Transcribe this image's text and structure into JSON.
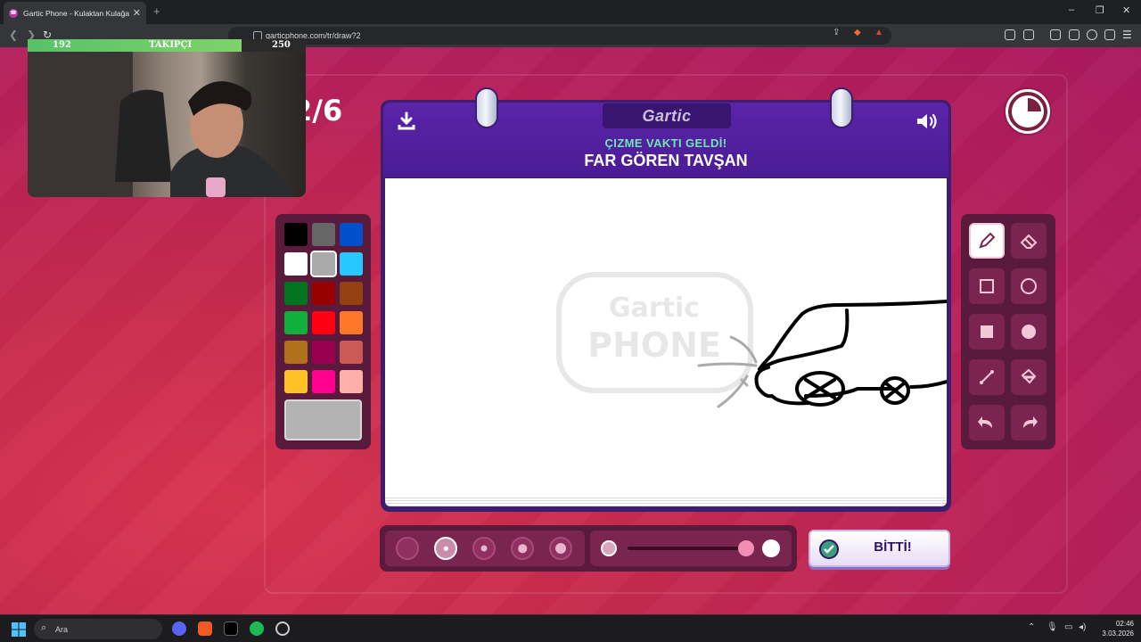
{
  "browser": {
    "tab_title": "Gartic Phone - Kulaktan Kulağa",
    "tab_close": "✕",
    "new_tab": "+",
    "url": "garticphone.com/tr/draw?2",
    "window_controls": [
      "–",
      "❐",
      "✕"
    ]
  },
  "stream": {
    "follow_current": "192",
    "follow_label": "TAKIPÇI",
    "follow_goal": "250",
    "follow_progress": 0.77
  },
  "game": {
    "round_text": "2/6",
    "logo_text": "Gartic",
    "subtitle": "ÇIZME VAKTI GELDİ!",
    "prompt": "FAR GÖREN TAVŞAN",
    "watermark_top": "Gartic",
    "watermark_bottom": "PHONE",
    "done_label": "BİTTİ!",
    "timer_remaining": 0.75,
    "palette": [
      "#000000",
      "#666666",
      "#0050cd",
      "#ffffff",
      "#aaaaaa",
      "#26c9ff",
      "#017420",
      "#990000",
      "#964112",
      "#11b03c",
      "#ff0013",
      "#ff7829",
      "#b0701c",
      "#99004e",
      "#cb5a57",
      "#ffc126",
      "#ff008f",
      "#feafa8"
    ],
    "selected_color": "#aaaaaa",
    "big_swatch_color": "#b3b3b3",
    "tools": [
      "pencil-icon",
      "eraser-icon",
      "rectangle-outline-icon",
      "circle-outline-icon",
      "rectangle-fill-icon",
      "circle-fill-icon",
      "line-icon",
      "bucket-icon",
      "undo-icon",
      "redo-icon"
    ],
    "selected_tool": "pencil-icon",
    "brush_sizes": 5,
    "selected_size": 2
  },
  "taskbar": {
    "search_placeholder": "Ara",
    "time": "02:46",
    "date": "3.03.2026"
  }
}
